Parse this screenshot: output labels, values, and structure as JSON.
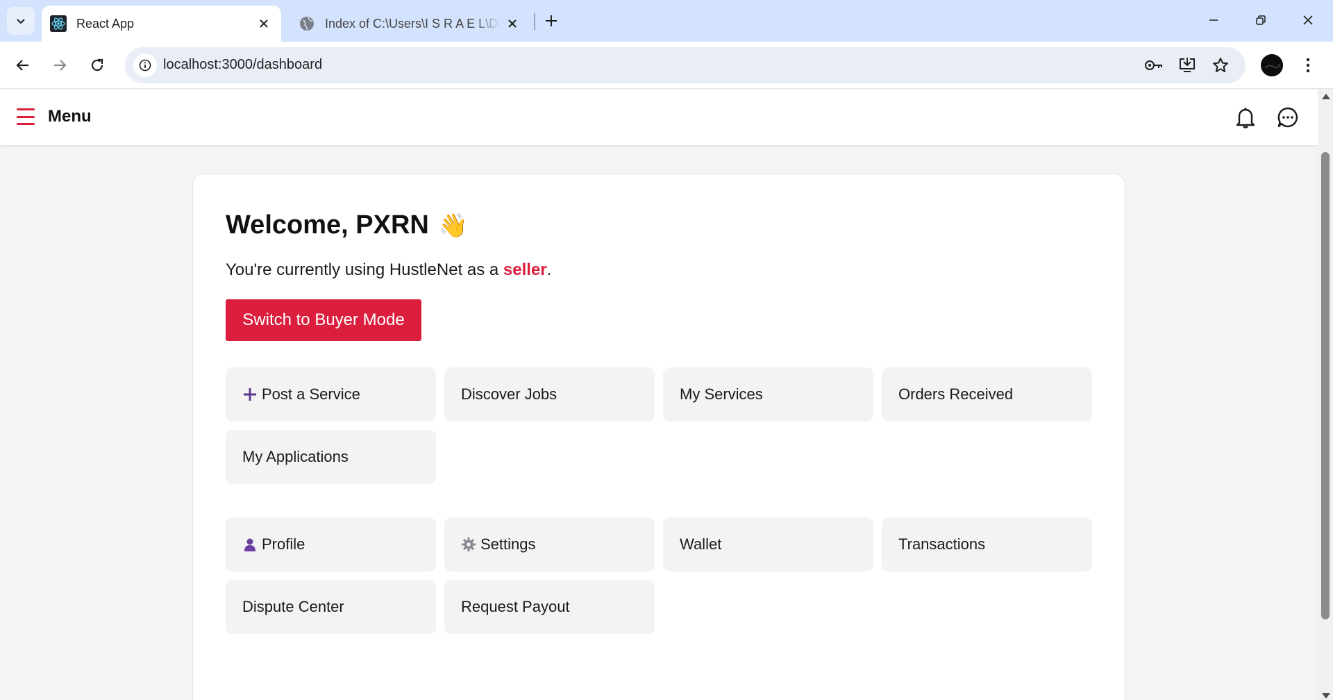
{
  "browser": {
    "tabs": [
      {
        "title": "React App",
        "active": true,
        "icon": "react-icon"
      },
      {
        "title": "Index of C:\\Users\\I S R A E L\\Desktop",
        "active": false,
        "icon": "globe-icon"
      }
    ],
    "url": "localhost:3000/dashboard"
  },
  "header": {
    "menu_label": "Menu",
    "icons": [
      "bell-icon",
      "chat-icon"
    ]
  },
  "dashboard": {
    "welcome_prefix": "Welcome, PXRN",
    "wave_emoji": "👋",
    "status_prefix": "You're currently using HustleNet as a ",
    "role": "seller",
    "status_suffix": ".",
    "switch_button": "Switch to Buyer Mode",
    "actions": [
      {
        "label": "Post a Service",
        "icon": "plus-icon"
      },
      {
        "label": "Discover Jobs"
      },
      {
        "label": "My Services"
      },
      {
        "label": "Orders Received"
      },
      {
        "label": "My Applications"
      }
    ],
    "account": [
      {
        "label": "Profile",
        "icon": "user-icon"
      },
      {
        "label": "Settings",
        "icon": "gear-icon"
      },
      {
        "label": "Wallet"
      },
      {
        "label": "Transactions"
      },
      {
        "label": "Dispute Center"
      },
      {
        "label": "Request Payout"
      }
    ]
  },
  "colors": {
    "accent": "#dc1e3e",
    "tile_bg": "#f3f3f3",
    "chrome_bg": "#d3e3fd"
  }
}
